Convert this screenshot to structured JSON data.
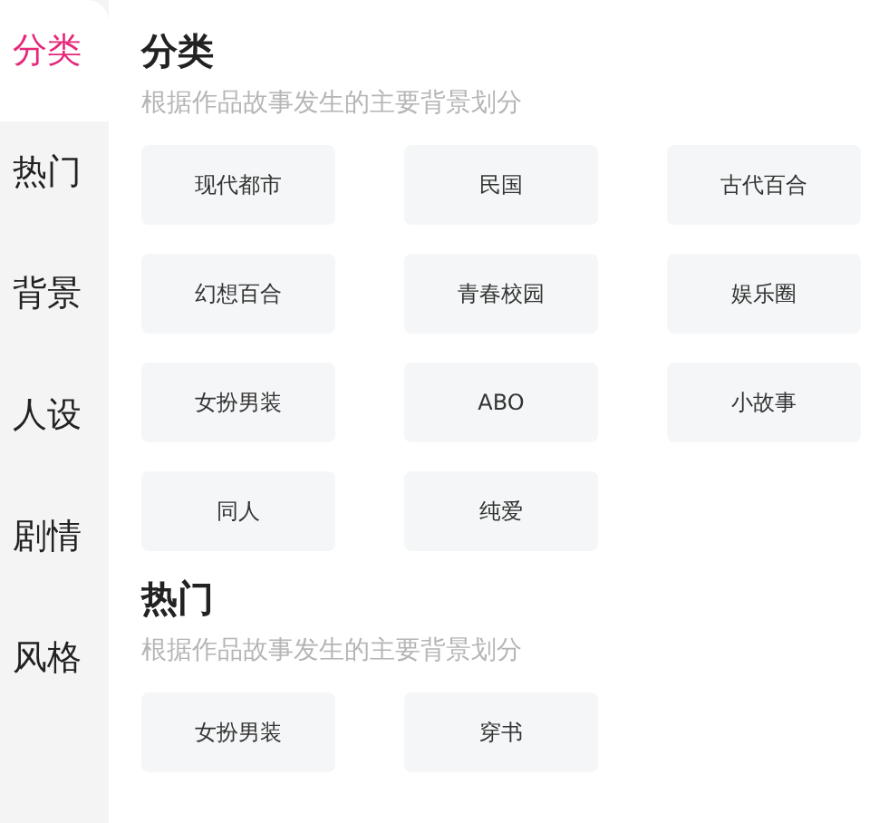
{
  "sidebar": {
    "items": [
      {
        "label": "分类",
        "selected": true
      },
      {
        "label": "热门",
        "selected": false
      },
      {
        "label": "背景",
        "selected": false
      },
      {
        "label": "人设",
        "selected": false
      },
      {
        "label": "剧情",
        "selected": false
      },
      {
        "label": "风格",
        "selected": false
      }
    ]
  },
  "sections": [
    {
      "title": "分类",
      "subtitle": "根据作品故事发生的主要背景划分",
      "tags": [
        "现代都市",
        "民国",
        "古代百合",
        "幻想百合",
        "青春校园",
        "娱乐圈",
        "女扮男装",
        "ABO",
        "小故事",
        "同人",
        "纯爱"
      ]
    },
    {
      "title": "热门",
      "subtitle": "根据作品故事发生的主要背景划分",
      "tags": [
        "女扮男装",
        "穿书"
      ]
    }
  ]
}
